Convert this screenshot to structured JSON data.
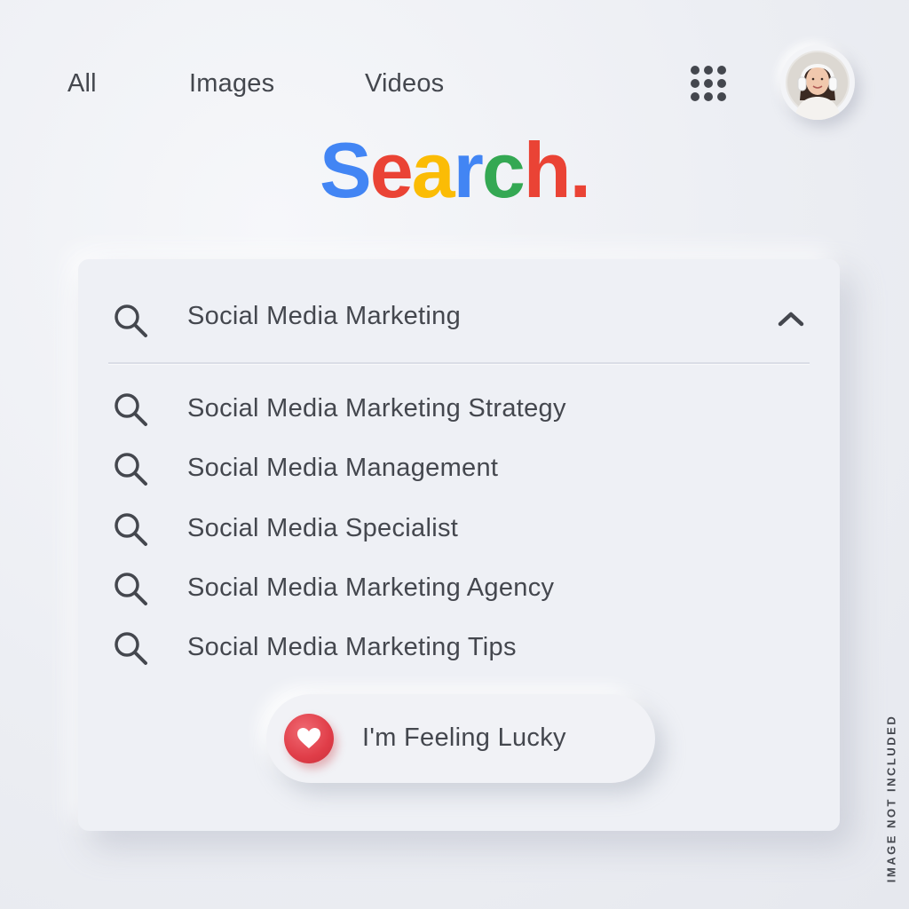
{
  "nav": {
    "tabs": [
      {
        "label": "All"
      },
      {
        "label": "Images"
      },
      {
        "label": "Videos"
      }
    ],
    "apps_icon": "grid-dots-icon",
    "avatar_icon": "user-avatar"
  },
  "logo": {
    "letters": [
      {
        "char": "S",
        "color": "#4285f4"
      },
      {
        "char": "e",
        "color": "#ea4335"
      },
      {
        "char": "a",
        "color": "#fbbc05"
      },
      {
        "char": "r",
        "color": "#4285f4"
      },
      {
        "char": "c",
        "color": "#34a853"
      },
      {
        "char": "h",
        "color": "#ea4335"
      },
      {
        "char": ".",
        "color": "#ea4335"
      }
    ]
  },
  "search": {
    "value": "Social Media Marketing",
    "icon": "search-icon",
    "collapse_icon": "chevron-up-icon"
  },
  "suggestions": [
    {
      "label": "Social Media Marketing Strategy"
    },
    {
      "label": "Social Media Management"
    },
    {
      "label": "Social Media Specialist"
    },
    {
      "label": "Social Media Marketing Agency"
    },
    {
      "label": "Social Media Marketing Tips"
    }
  ],
  "lucky_button": {
    "label": "I'm Feeling Lucky",
    "icon": "heart-icon",
    "accent": "#e03d48"
  },
  "side_note": "IMAGE NOT INCLUDED"
}
